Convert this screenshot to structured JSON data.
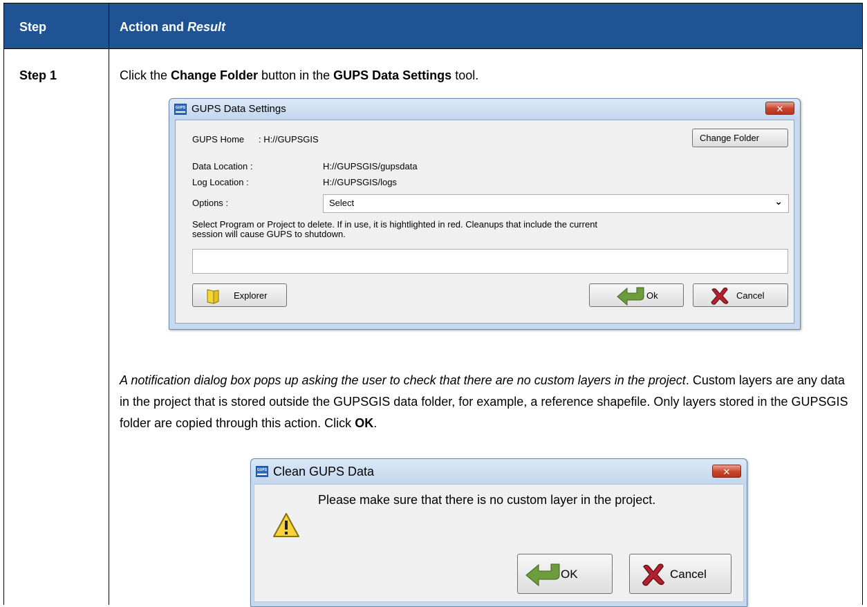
{
  "table": {
    "header_step": "Step",
    "header_action": "Action and",
    "header_result": "Result",
    "step1_label": "Step 1",
    "step1_pre": "Click the ",
    "step1_b1": "Change Folder",
    "step1_mid": " button in the ",
    "step1_b2": "GUPS Data Settings",
    "step1_post": " tool.",
    "para_italic": "A notification dialog box pops up asking the user to check that there are no custom layers in the project",
    "para_text": ". Custom layers are any data in the project that is stored outside the GUPSGIS data folder, for example, a reference shapefile. Only layers stored in the GUPSGIS folder are copied through this action. Click ",
    "para_bold": "OK",
    "para_end": "."
  },
  "settings_dialog": {
    "title": "GUPS Data Settings",
    "app_icon": "GUPS",
    "close": "✕",
    "gups_home_label": "GUPS Home",
    "gups_home_value": ": H://GUPSGIS",
    "change_folder": "Change Folder",
    "data_location_label": "Data Location  :",
    "data_location_value": "H://GUPSGIS/gupsdata",
    "log_location_label": "Log Location  :",
    "log_location_value": "H://GUPSGIS/logs",
    "options_label": "Options :",
    "options_value": "Select",
    "note_line1": "Select Program or Project to delete. If in use, it is hightlighted in red. Cleanups that include the current",
    "note_line2": "session will cause GUPS to shutdown.",
    "text_value": "",
    "explorer": "Explorer",
    "ok": "Ok",
    "cancel": "Cancel"
  },
  "clean_dialog": {
    "title": "Clean GUPS Data",
    "app_icon": "GUPS",
    "close": "✕",
    "message": "Please make sure that there is no custom layer in the project.",
    "ok": "OK",
    "cancel": "Cancel"
  },
  "icons": {
    "warning": "warning-icon",
    "folder": "folder-icon",
    "ok_arrow": "return-arrow-icon",
    "cancel_x": "red-x-icon"
  },
  "colors": {
    "header_bg": "#1f5393",
    "dialog_frame": "#c6d9ef",
    "close_red": "#c7432b"
  }
}
